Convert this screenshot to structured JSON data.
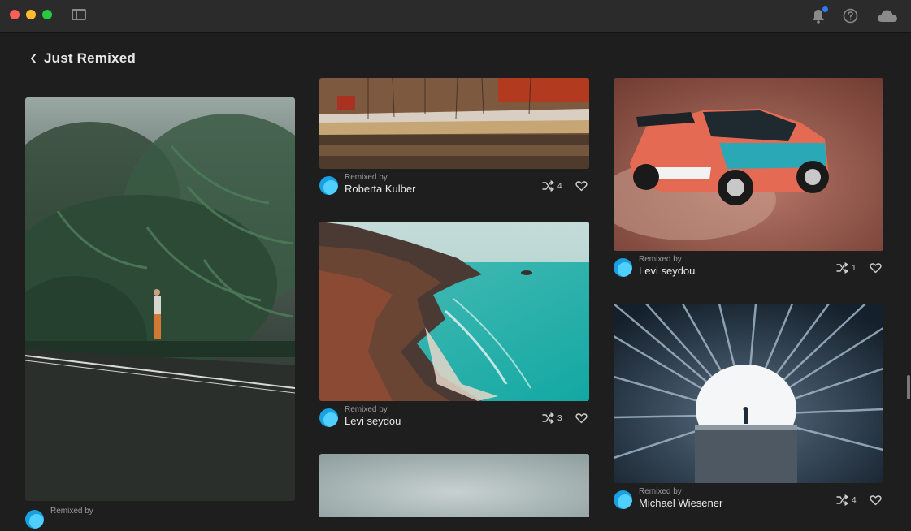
{
  "header": {
    "title": "Just Remixed"
  },
  "cards": [
    {
      "remixed_label": "Remixed by",
      "author": "",
      "remix_count": ""
    },
    {
      "remixed_label": "Remixed by",
      "author": "Roberta Kulber",
      "remix_count": "4"
    },
    {
      "remixed_label": "Remixed by",
      "author": "Levi seydou",
      "remix_count": "3"
    },
    {
      "remixed_label": "Remixed by",
      "author": "Levi seydou",
      "remix_count": "1"
    },
    {
      "remixed_label": "Remixed by",
      "author": "Michael Wiesener",
      "remix_count": "4"
    }
  ],
  "colors": {
    "background": "#1e1e1e",
    "titlebar": "#2b2b2b",
    "accent": "#2e7cf6",
    "avatar": "#4fd0ff"
  },
  "icons": {
    "bell": "bell-icon",
    "help": "help-icon",
    "cloud": "cloud-icon",
    "back": "chevron-left-icon",
    "remix": "remix-icon",
    "like": "heart-icon"
  }
}
